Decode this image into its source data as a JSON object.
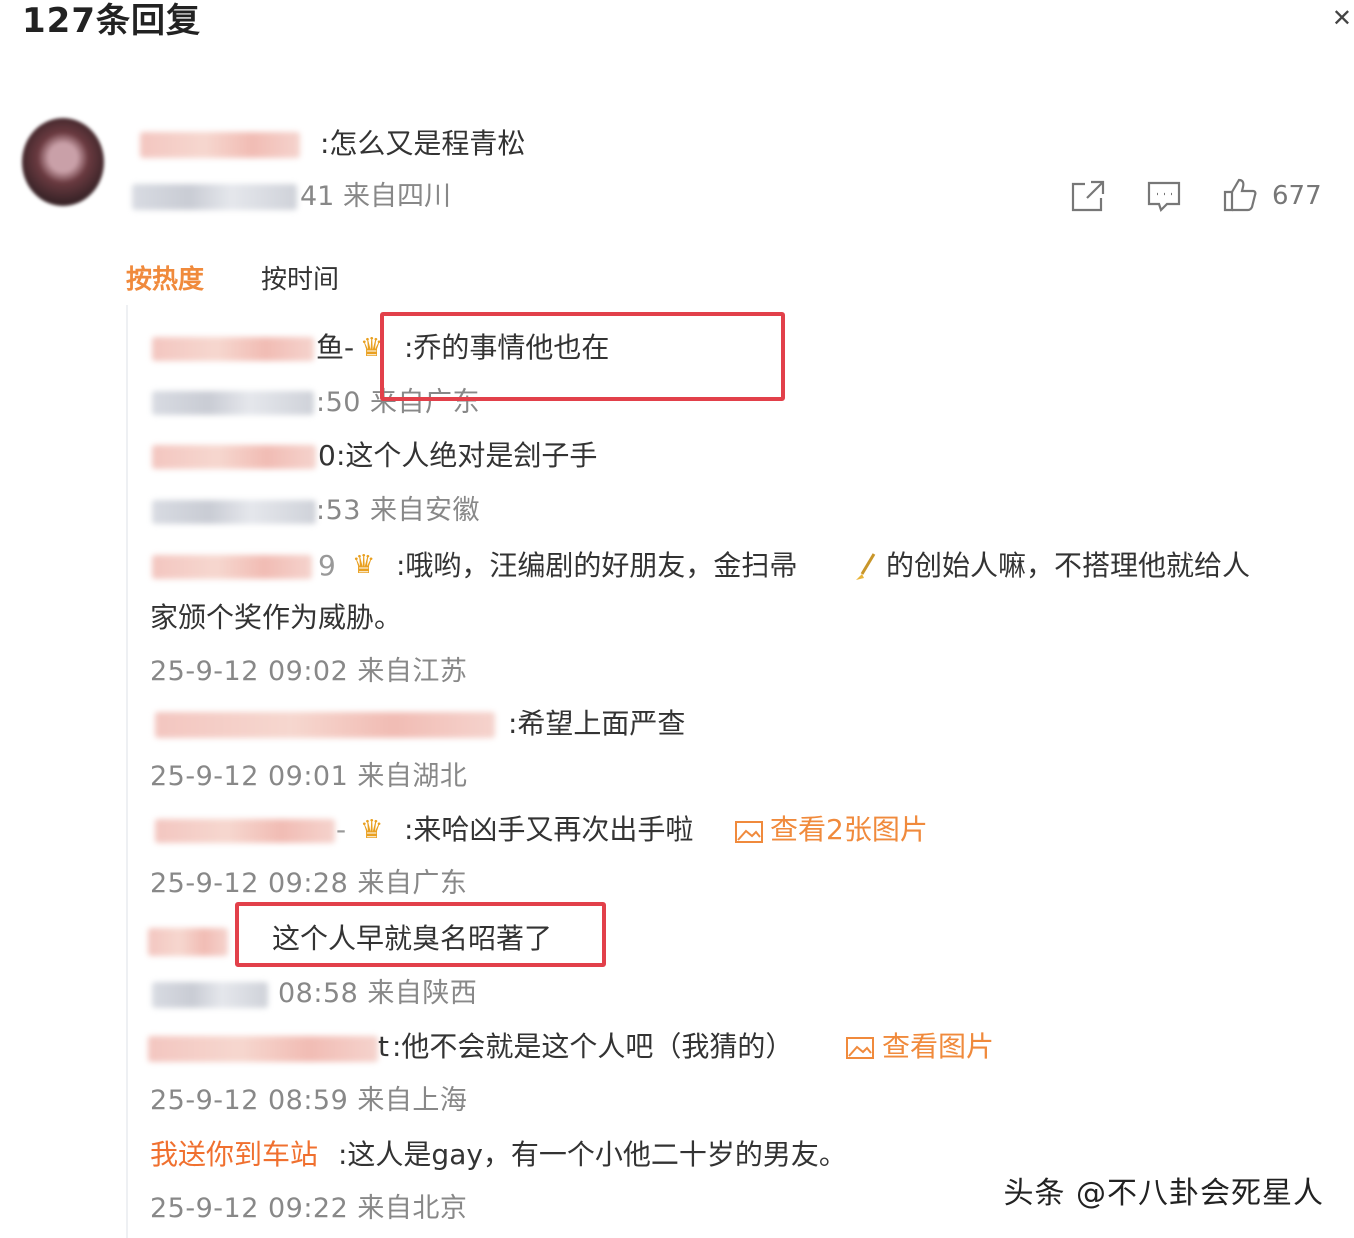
{
  "header": {
    "title": "127条回复"
  },
  "main_comment": {
    "text": ":怎么又是程青松",
    "meta": "41 来自四川",
    "likes": "677"
  },
  "sort": {
    "hot": "按热度",
    "time": "按时间"
  },
  "replies": [
    {
      "name_suffix": "鱼-",
      "text": ":乔的事情他也在",
      "meta": ":50 来自广东"
    },
    {
      "name_suffix": "0",
      "text": ":这个人绝对是刽子手",
      "meta": ":53 来自安徽"
    },
    {
      "name_suffix": "9",
      "text_line1": ":哦哟，汪编剧的好朋友，金扫帚",
      "text_line1b": "的创始人嘛，不搭理他就给人",
      "text_line2": "家颁个奖作为威胁。",
      "meta": "25-9-12 09:02 来自江苏"
    },
    {
      "text": ":希望上面严查",
      "meta": "25-9-12 09:01 来自湖北"
    },
    {
      "name_suffix": "-",
      "text": ":来哈凶手又再次出手啦",
      "link": "查看2张图片",
      "meta": "25-9-12 09:28 来自广东"
    },
    {
      "text": "这个人早就臭名昭著了",
      "meta": "08:58 来自陕西"
    },
    {
      "name_suffix": "t",
      "text": ":他不会就是这个人吧（我猜的）",
      "link": "查看图片",
      "meta": "25-9-12 08:59 来自上海"
    },
    {
      "name": "我送你到车站",
      "text": ":这人是gay，有一个小他二十岁的男友。",
      "meta": "25-9-12 09:22 来自北京"
    }
  ],
  "watermark": "头条 @不八卦会死星人",
  "colors": {
    "accent_orange": "#f08a3c",
    "highlight_red": "#e2404a",
    "meta_gray": "#888888"
  }
}
